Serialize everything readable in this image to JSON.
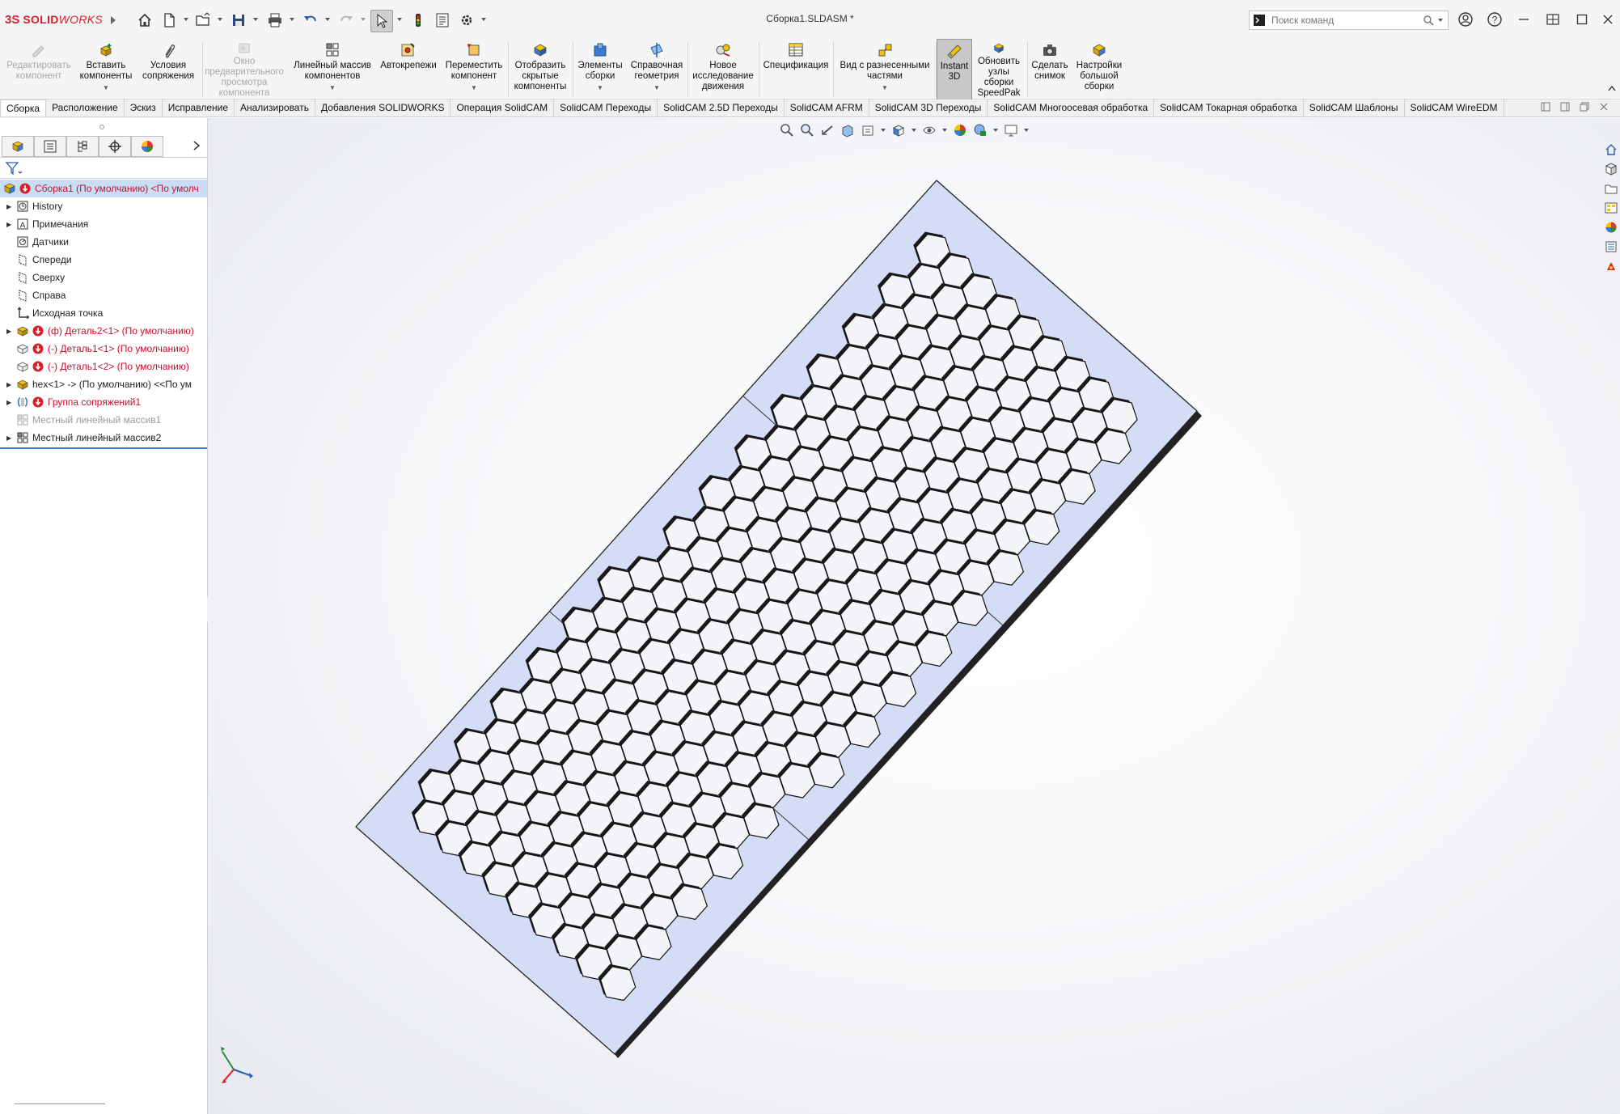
{
  "app": {
    "brand_ds": "3S",
    "brand_name": "SOLID",
    "brand_name_italic": "WORKS",
    "document_title": "Сборка1.SLDASM *"
  },
  "search": {
    "placeholder": "Поиск команд"
  },
  "ribbon": {
    "buttons": [
      {
        "label": "Редактировать\nкомпонент",
        "enabled": false
      },
      {
        "label": "Вставить\nкомпоненты",
        "enabled": true,
        "dropdown": true
      },
      {
        "label": "Условия\nсопряжения",
        "enabled": true
      },
      {
        "label": "Окно\nпредварительного\nпросмотра\nкомпонента",
        "enabled": false
      },
      {
        "label": "Линейный массив\nкомпонентов",
        "enabled": true,
        "dropdown": true
      },
      {
        "label": "Автокрепежи",
        "enabled": true
      },
      {
        "label": "Переместить\nкомпонент",
        "enabled": true,
        "dropdown": true
      },
      {
        "label": "Отобразить\nскрытые\nкомпоненты",
        "enabled": true
      },
      {
        "label": "Элементы\nсборки",
        "enabled": true,
        "dropdown": true
      },
      {
        "label": "Справочная\nгеометрия",
        "enabled": true,
        "dropdown": true
      },
      {
        "label": "Новое\nисследование\nдвижения",
        "enabled": true
      },
      {
        "label": "Спецификация",
        "enabled": true
      },
      {
        "label": "Вид с разнесенными\nчастями",
        "enabled": true,
        "dropdown": true
      },
      {
        "label": "Instant\n3D",
        "enabled": true,
        "active": true
      },
      {
        "label": "Обновить\nузлы\nсборки\nSpeedPak",
        "enabled": true
      },
      {
        "label": "Сделать\nснимок",
        "enabled": true
      },
      {
        "label": "Настройки\nбольшой\nсборки",
        "enabled": true
      }
    ]
  },
  "tabs": [
    {
      "label": "Сборка",
      "active": true
    },
    {
      "label": "Расположение"
    },
    {
      "label": "Эскиз"
    },
    {
      "label": "Исправление"
    },
    {
      "label": "Анализировать"
    },
    {
      "label": "Добавления SOLIDWORKS"
    },
    {
      "label": "Операция  SolidCAM"
    },
    {
      "label": "SolidCAM Переходы"
    },
    {
      "label": "SolidCAM 2.5D Переходы"
    },
    {
      "label": "SolidCAM AFRM"
    },
    {
      "label": "SolidCAM 3D Переходы"
    },
    {
      "label": "SolidCAM Многоосевая обработка"
    },
    {
      "label": "SolidCAM Токарная обработка"
    },
    {
      "label": "SolidCAM Шаблоны"
    },
    {
      "label": "SolidCAM WireEDM"
    }
  ],
  "tree": {
    "root": "Сборка1 (По умолчанию) <По умолч",
    "items": [
      {
        "label": "History",
        "icon": "history-icon",
        "expandable": true,
        "color": "normal"
      },
      {
        "label": "Примечания",
        "icon": "annotations-icon",
        "expandable": true,
        "color": "normal"
      },
      {
        "label": "Датчики",
        "icon": "sensors-icon",
        "expandable": false,
        "color": "normal"
      },
      {
        "label": "Спереди",
        "icon": "plane-icon",
        "expandable": false,
        "color": "normal"
      },
      {
        "label": "Сверху",
        "icon": "plane-icon",
        "expandable": false,
        "color": "normal"
      },
      {
        "label": "Справа",
        "icon": "plane-icon",
        "expandable": false,
        "color": "normal"
      },
      {
        "label": "Исходная точка",
        "icon": "origin-icon",
        "expandable": false,
        "color": "normal"
      },
      {
        "label": "(ф) Деталь2<1> (По умолчанию)",
        "icon": "part-icon",
        "expandable": true,
        "color": "red",
        "error": true
      },
      {
        "label": "(-) Деталь1<1> (По умолчанию)",
        "icon": "part-outline-icon",
        "expandable": false,
        "color": "red",
        "error": true
      },
      {
        "label": "(-) Деталь1<2> (По умолчанию)",
        "icon": "part-outline-icon",
        "expandable": false,
        "color": "red",
        "error": true
      },
      {
        "label": "hex<1> -> (По умолчанию) <<По ум",
        "icon": "part-icon",
        "expandable": true,
        "color": "normal"
      },
      {
        "label": "Группа сопряжений1",
        "icon": "mates-icon",
        "expandable": true,
        "color": "red",
        "error": true
      },
      {
        "label": "Местный линейный массив1",
        "icon": "pattern-icon",
        "expandable": false,
        "color": "grey"
      },
      {
        "label": "Местный линейный массив2",
        "icon": "pattern-icon",
        "expandable": true,
        "color": "normal"
      }
    ]
  },
  "colors": {
    "accent_red": "#c8102e",
    "plate_fill": "#d4dcf6",
    "selection": "#c9def5"
  }
}
